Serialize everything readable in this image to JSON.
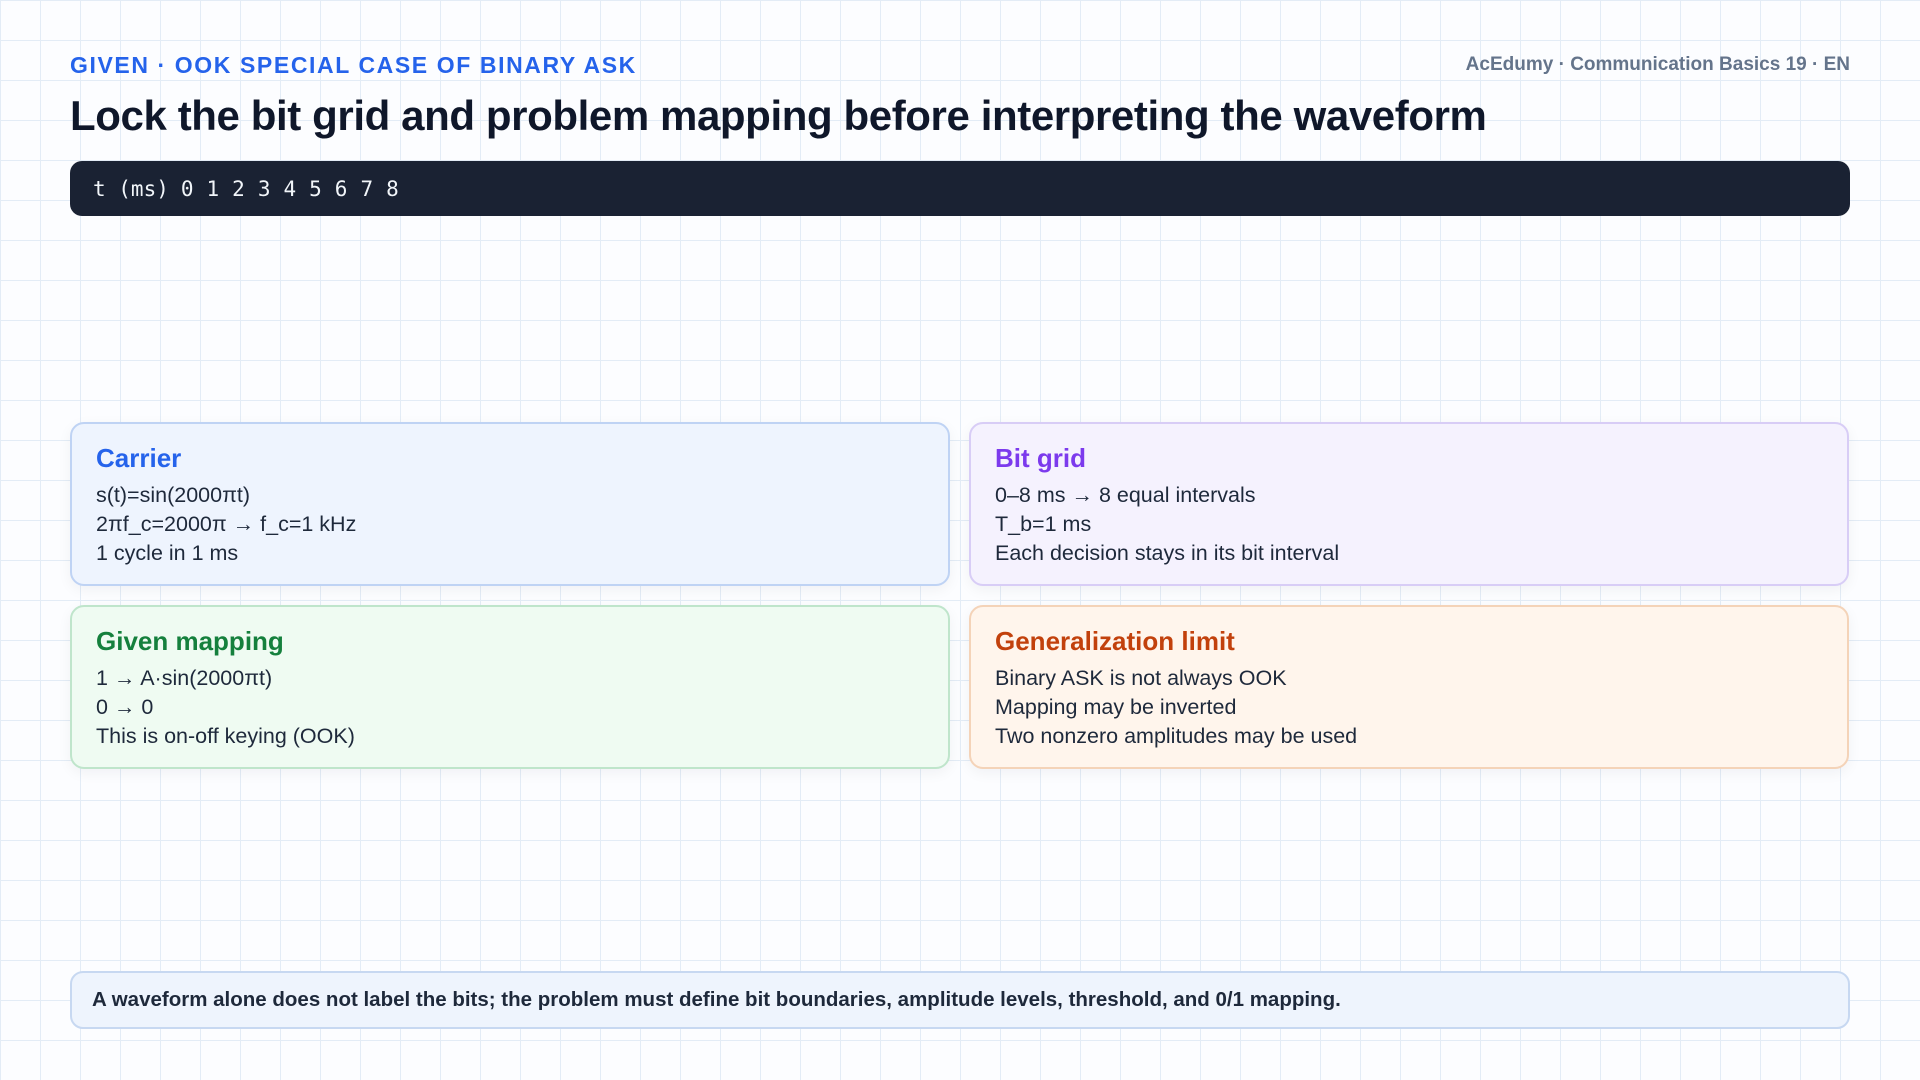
{
  "header": {
    "kicker": "GIVEN · OOK SPECIAL CASE OF BINARY ASK",
    "brand": "AcEdumy · Communication Basics 19 · EN",
    "title": "Lock the bit grid and problem mapping before interpreting the waveform"
  },
  "time_axis": {
    "label": "t (ms)",
    "ticks": [
      "0",
      "1",
      "2",
      "3",
      "4",
      "5",
      "6",
      "7",
      "8"
    ]
  },
  "cards": [
    {
      "title": "Carrier",
      "accent": "#2563eb",
      "lines": [
        "s(t)=sin(2000πt)",
        "2πf_c=2000π → f_c=1 kHz",
        "1 cycle in 1 ms"
      ]
    },
    {
      "title": "Bit grid",
      "accent": "#7c3aed",
      "lines": [
        "0–8 ms → 8 equal intervals",
        "T_b=1 ms",
        "Each decision stays in its bit interval"
      ]
    },
    {
      "title": "Given mapping",
      "accent": "#15803d",
      "lines": [
        "1 → A·sin(2000πt)",
        "0 → 0",
        "This is on-off keying (OOK)"
      ]
    },
    {
      "title": "Generalization limit",
      "accent": "#c2410c",
      "lines": [
        "Binary ASK is not always OOK",
        "Mapping may be inverted",
        "Two nonzero amplitudes may be used"
      ]
    }
  ],
  "footer": {
    "note": "A waveform alone does not label the bits; the problem must define bit boundaries, amplitude levels, threshold, and 0/1 mapping."
  }
}
